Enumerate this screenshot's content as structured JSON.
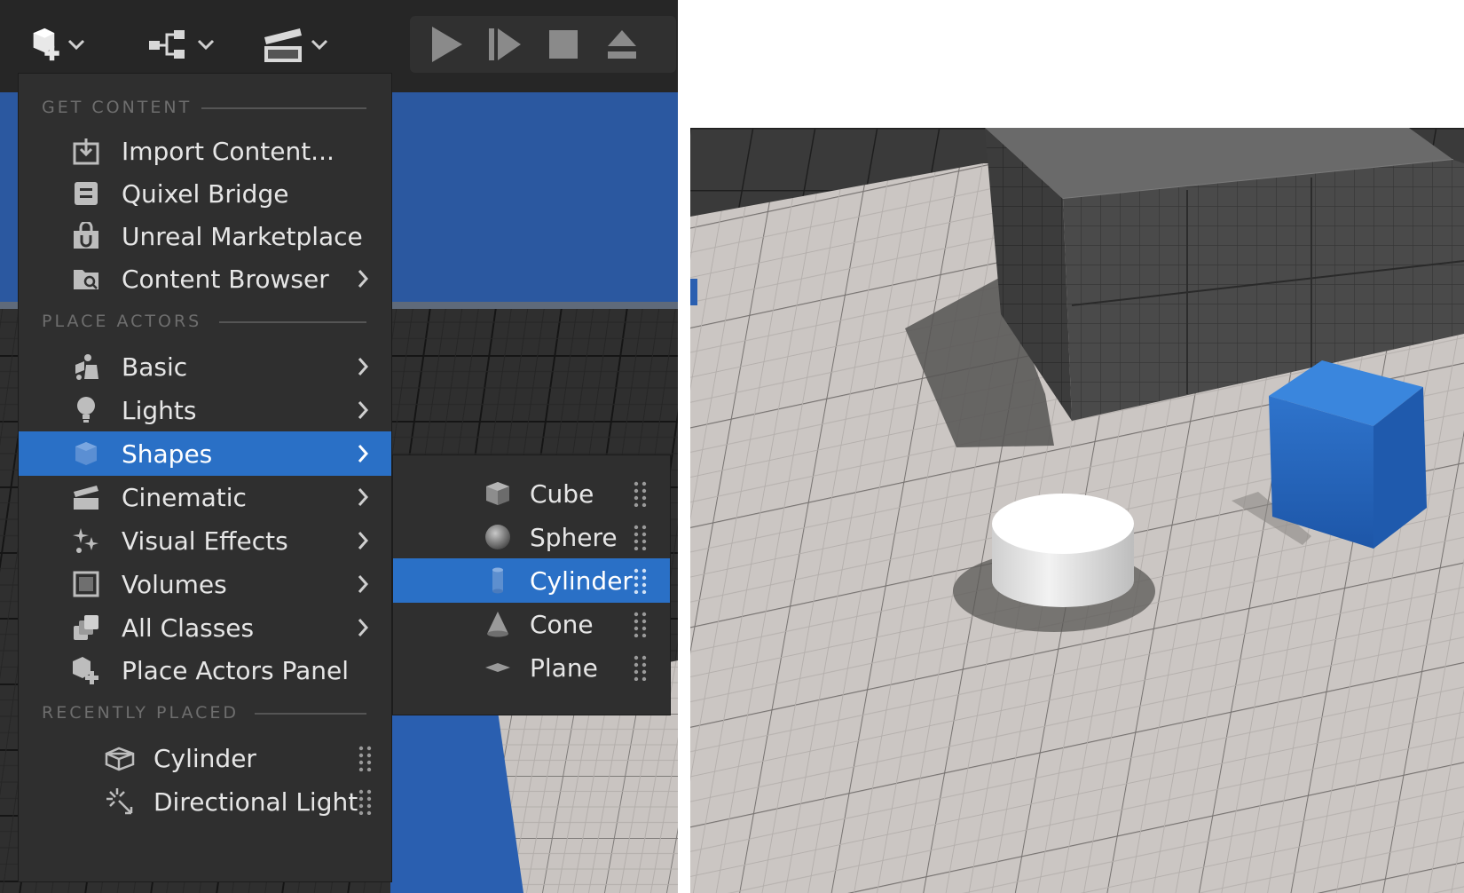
{
  "toolbar": {
    "icons": [
      "add-content-icon",
      "blueprint-icon",
      "cinematics-icon",
      "play-icon",
      "advance-frame-icon",
      "stop-icon",
      "eject-icon"
    ]
  },
  "menu": {
    "sections": {
      "get_content": "GET CONTENT",
      "place_actors": "PLACE ACTORS",
      "recently_placed": "RECENTLY PLACED"
    },
    "get_content_items": [
      {
        "label": "Import Content...",
        "icon": "import-icon",
        "submenu": false
      },
      {
        "label": "Quixel Bridge",
        "icon": "bridge-icon",
        "submenu": false
      },
      {
        "label": "Unreal Marketplace",
        "icon": "marketplace-icon",
        "submenu": false
      },
      {
        "label": "Content Browser",
        "icon": "folder-icon",
        "submenu": true
      }
    ],
    "place_actor_items": [
      {
        "label": "Basic",
        "icon": "basic-actors-icon",
        "submenu": true
      },
      {
        "label": "Lights",
        "icon": "light-bulb-icon",
        "submenu": true
      },
      {
        "label": "Shapes",
        "icon": "shapes-icon",
        "submenu": true,
        "active": true
      },
      {
        "label": "Cinematic",
        "icon": "cinematic-icon",
        "submenu": true
      },
      {
        "label": "Visual Effects",
        "icon": "visual-effects-icon",
        "submenu": true
      },
      {
        "label": "Volumes",
        "icon": "volumes-icon",
        "submenu": true
      },
      {
        "label": "All Classes",
        "icon": "all-classes-icon",
        "submenu": true
      },
      {
        "label": "Place Actors Panel",
        "icon": "place-actors-icon",
        "submenu": false
      }
    ],
    "recent_items": [
      {
        "label": "Cylinder",
        "icon": "cylinder-icon"
      },
      {
        "label": "Directional Light",
        "icon": "directional-light-icon"
      }
    ]
  },
  "shapes_submenu": [
    {
      "label": "Cube",
      "icon": "cube-icon"
    },
    {
      "label": "Sphere",
      "icon": "sphere-icon"
    },
    {
      "label": "Cylinder",
      "icon": "cylinder-icon",
      "active": true
    },
    {
      "label": "Cone",
      "icon": "cone-icon"
    },
    {
      "label": "Plane",
      "icon": "plane-icon"
    }
  ],
  "colors": {
    "accent": "#2a70c6",
    "menu_bg": "#2f2f2f",
    "toolbar_bg": "#262626",
    "text": "#e6e6e6",
    "section_text": "#6e6e6e"
  }
}
